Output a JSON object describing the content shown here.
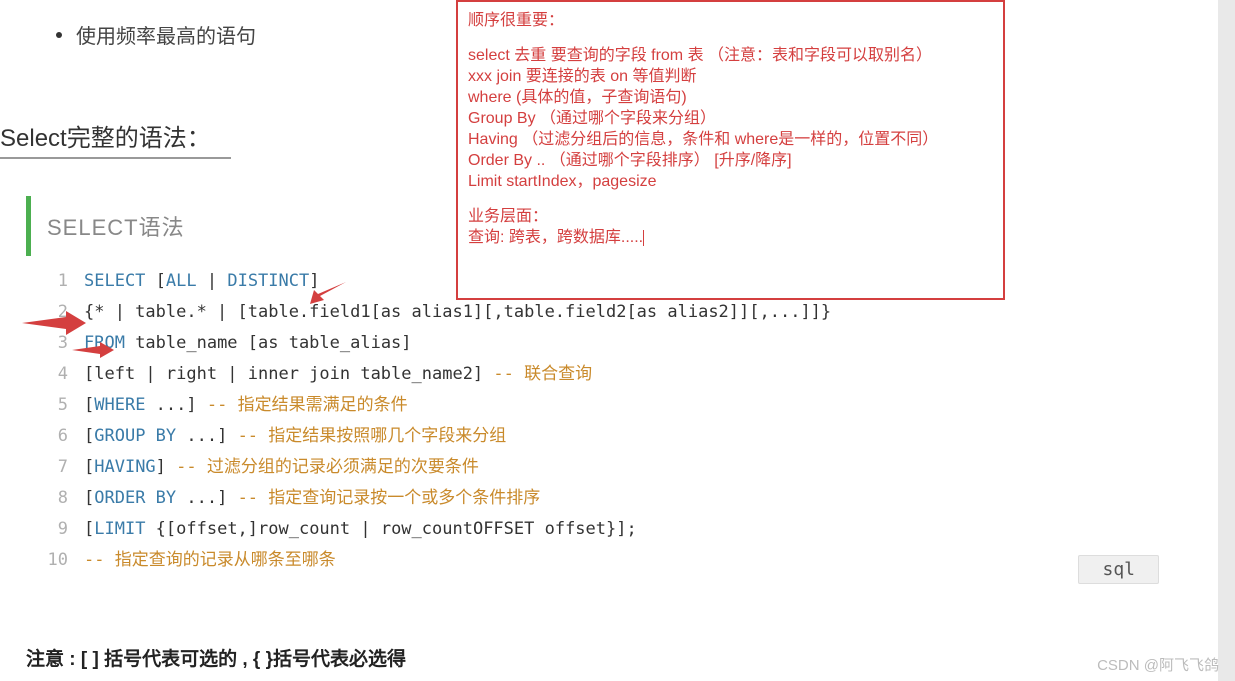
{
  "bullet": "使用频率最高的语句",
  "heading": "Select完整的语法：",
  "section_title": "SELECT语法",
  "code": {
    "lines": [
      {
        "n": "1",
        "pre": "",
        "kw": "SELECT",
        "mid": " [",
        "kw2": "ALL",
        "mid2": " | ",
        "kw3": "DISTINCT",
        "post": "]"
      },
      {
        "n": "2",
        "plain": "{* | table.* | [table.field1[as alias1][,table.field2[as alias2]][,...]]}"
      },
      {
        "n": "3",
        "kw": "FROM",
        "plain": " table_name [as table_alias]"
      },
      {
        "n": "4",
        "plain": "    [left | right | inner join table_name2]  ",
        "cmt": "-- 联合查询"
      },
      {
        "n": "5",
        "pre": "    [",
        "kw": "WHERE",
        "plain": " ...]   ",
        "cmt": "-- 指定结果需满足的条件"
      },
      {
        "n": "6",
        "pre": "    [",
        "kw": "GROUP BY",
        "plain": " ...]   ",
        "cmt": "-- 指定结果按照哪几个字段来分组"
      },
      {
        "n": "7",
        "pre": "    [",
        "kw": "HAVING",
        "plain": "]   ",
        "cmt": "-- 过滤分组的记录必须满足的次要条件"
      },
      {
        "n": "8",
        "pre": "    [",
        "kw": "ORDER BY",
        "plain": " ...]   ",
        "cmt": "-- 指定查询记录按一个或多个条件排序"
      },
      {
        "n": "9",
        "pre": "    [",
        "kw": "LIMIT",
        "plain": " {[offset,]row_count | row_countOFFSET offset}];"
      },
      {
        "n": "10",
        "plain": "    ",
        "cmt": "--  指定查询的记录从哪条至哪条"
      }
    ],
    "lang": "sql"
  },
  "note": "注意 : [ ] 括号代表可选的 , { }括号代表必选得",
  "redbox": {
    "p1": "顺序很重要：",
    "l1": "select 去重 要查询的字段 from 表  （注意：表和字段可以取别名）",
    "l2": "xxx join 要连接的表  on  等值判断",
    "l3": "where (具体的值，子查询语句)",
    "l4": "Group By  （通过哪个字段来分组）",
    "l5": "Having  （过滤分组后的信息，条件和 where是一样的，位置不同）",
    "l6": "Order By .. （通过哪个字段排序） [升序/降序]",
    "l7": "Limit  startIndex，pagesize",
    "p3a": "业务层面：",
    "p3b": "查询: 跨表，跨数据库....."
  },
  "watermark": "CSDN @阿飞飞鸽"
}
